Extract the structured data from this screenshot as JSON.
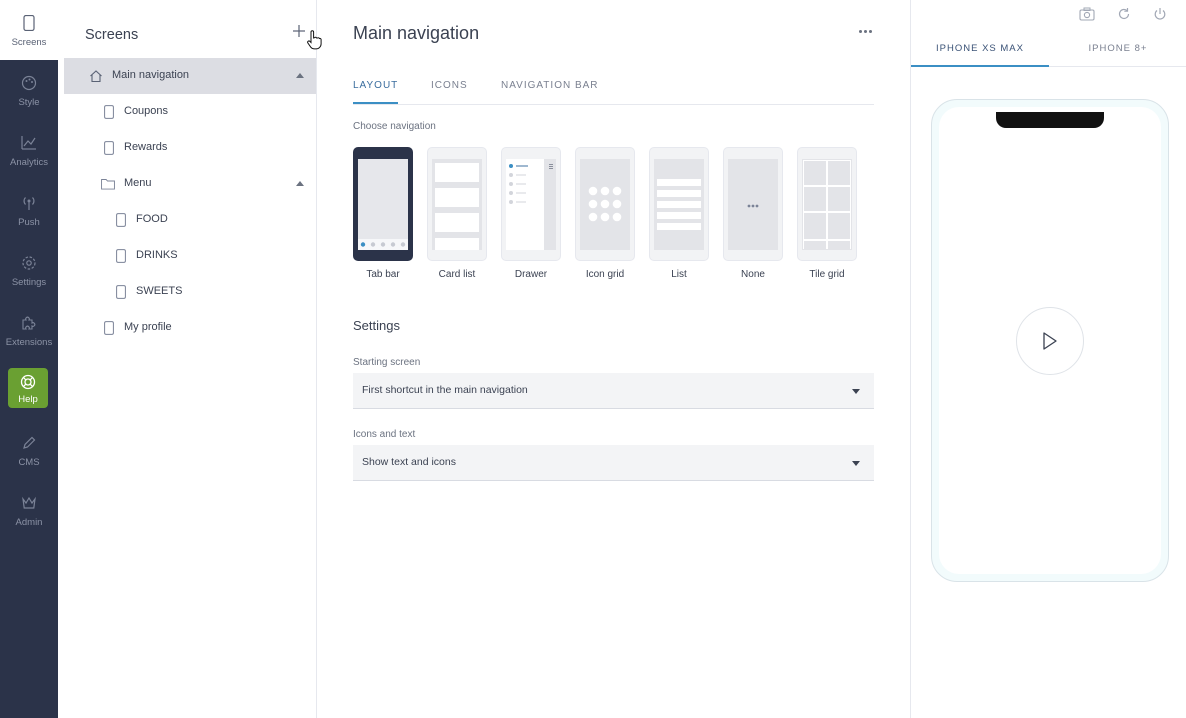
{
  "rail": {
    "items": [
      {
        "label": "Screens",
        "icon": "phone-icon"
      },
      {
        "label": "Style",
        "icon": "palette-icon"
      },
      {
        "label": "Analytics",
        "icon": "chart-icon"
      },
      {
        "label": "Push",
        "icon": "broadcast-icon"
      },
      {
        "label": "Settings",
        "icon": "gear-icon"
      },
      {
        "label": "Extensions",
        "icon": "puzzle-icon"
      },
      {
        "label": "Help",
        "icon": "lifebuoy-icon"
      },
      {
        "label": "CMS",
        "icon": "pencil-icon"
      },
      {
        "label": "Admin",
        "icon": "crown-icon"
      }
    ]
  },
  "screens_panel": {
    "title": "Screens",
    "tree": [
      {
        "label": "Main navigation",
        "icon": "home-icon"
      },
      {
        "label": "Coupons",
        "icon": "page-icon"
      },
      {
        "label": "Rewards",
        "icon": "page-icon"
      },
      {
        "label": "Menu",
        "icon": "folder-icon"
      },
      {
        "label": "FOOD",
        "icon": "page-icon"
      },
      {
        "label": "DRINKS",
        "icon": "page-icon"
      },
      {
        "label": "SWEETS",
        "icon": "page-icon"
      },
      {
        "label": "My profile",
        "icon": "page-icon"
      }
    ]
  },
  "main": {
    "title": "Main navigation",
    "tabs": [
      {
        "label": "LAYOUT"
      },
      {
        "label": "ICONS"
      },
      {
        "label": "NAVIGATION BAR"
      }
    ],
    "choose_label": "Choose navigation",
    "nav_options": [
      {
        "label": "Tab bar"
      },
      {
        "label": "Card list"
      },
      {
        "label": "Drawer"
      },
      {
        "label": "Icon grid"
      },
      {
        "label": "List"
      },
      {
        "label": "None"
      },
      {
        "label": "Tile grid"
      }
    ],
    "settings_title": "Settings",
    "starting_screen": {
      "label": "Starting screen",
      "value": "First shortcut in the main navigation"
    },
    "icons_text": {
      "label": "Icons and text",
      "value": "Show text and icons"
    }
  },
  "preview": {
    "device_tabs": [
      {
        "label": "IPHONE XS MAX"
      },
      {
        "label": "IPHONE 8+"
      }
    ]
  },
  "colors": {
    "rail_bg": "#2b3349",
    "accent": "#3b8fc4",
    "help_green": "#6aa032",
    "selected_row": "#dcdde3"
  }
}
